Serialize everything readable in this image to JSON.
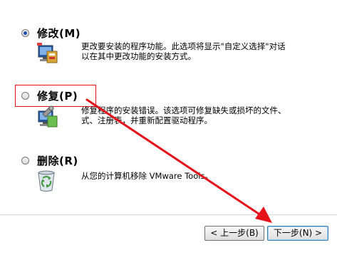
{
  "options": [
    {
      "label": "修改(M)",
      "selected": true,
      "description_lines": [
        "更改要安装的程序功能。此选项将显示\"自定义选择\"对话",
        "以在其中更改功能的安装方式。"
      ],
      "icon": "installer-computer-icon"
    },
    {
      "label": "修复(P)",
      "selected": false,
      "description_lines": [
        "修复程序的安装错误。该选项可修复缺失或损坏的文件、",
        "式、注册表，并重新配置驱动程序。"
      ],
      "icon": "repair-computer-icon"
    },
    {
      "label": "删除(R)",
      "selected": false,
      "description_lines": [
        "从您的计算机移除 VMware Tools。"
      ],
      "icon": "recycle-bin-icon"
    }
  ],
  "buttons": {
    "back": "< 上一步(B)",
    "next": "下一步(N) >"
  },
  "colors": {
    "annotation": "#e5121a",
    "radio_selected": "#1d4fb0"
  }
}
